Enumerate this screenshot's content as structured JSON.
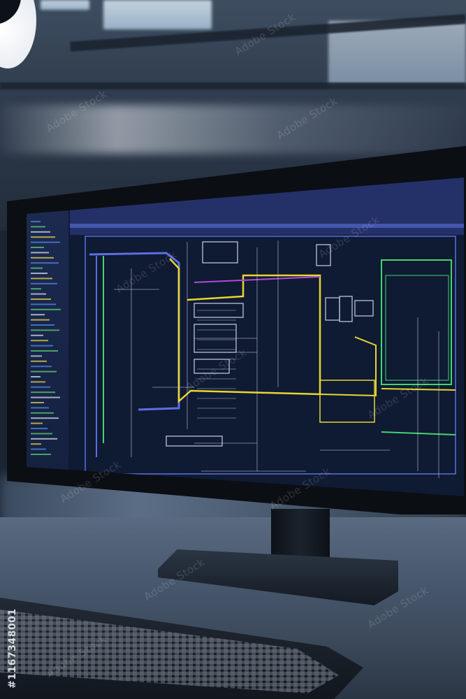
{
  "watermark": {
    "text": "Adobe Stock",
    "stock_id": "#1167348001"
  },
  "colors": {
    "schematic_blue": "#5b6fe0",
    "schematic_yellow": "#e8d630",
    "schematic_green": "#46d46e",
    "schematic_white": "#c8d0e8",
    "schematic_magenta": "#b04ad6",
    "screen_bg": "#0f1a33"
  },
  "scene": {
    "objects": [
      "monitor",
      "circuit-schematic",
      "monitor-stand",
      "keyboard",
      "desk",
      "ceiling-lamp",
      "skylights"
    ]
  }
}
